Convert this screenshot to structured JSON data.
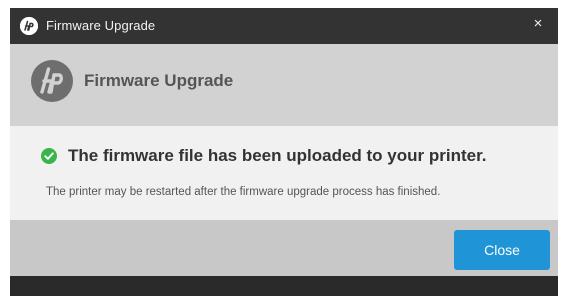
{
  "window": {
    "title": "Firmware Upgrade",
    "close_glyph": "×",
    "logo_icon": "hp-logo-icon"
  },
  "header": {
    "title": "Firmware Upgrade",
    "logo_icon": "hp-logo-icon"
  },
  "message": {
    "status_icon": "check-circle-icon",
    "heading": "The firmware file has been uploaded to your printer.",
    "detail": "The printer may be restarted after the firmware upgrade process has finished."
  },
  "footer": {
    "close_label": "Close"
  },
  "colors": {
    "titlebar": "#333333",
    "header_bg": "#d2d2d2",
    "message_bg": "#f1f1f1",
    "footer_bg": "#c8c8c8",
    "accent": "#1f94d6",
    "success": "#3ab54a"
  }
}
